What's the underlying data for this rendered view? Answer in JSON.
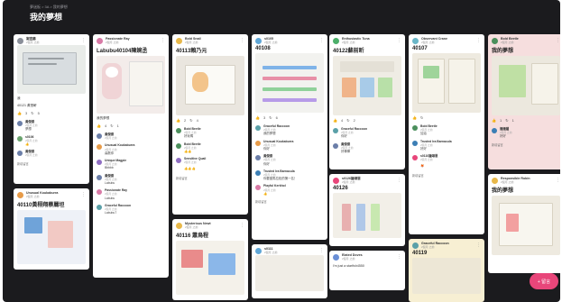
{
  "breadcrumb": "夢迷板 > 3A > 我的夢想",
  "title": "我的夢想",
  "comment_placeholder": "新增留言",
  "fab_label": "+ 留言",
  "like_icon": "👍",
  "reply_icon": "↻",
  "menu_icon": "⋮",
  "columns": [
    {
      "cards": [
        {
          "author": "謝宜蓁",
          "time": "2個月 之前",
          "title": "",
          "note": "我",
          "likes": "3",
          "comments": "5",
          "caption": "40121 黃慧軒",
          "comments_list": [
            {
              "name": "黃傑傑",
              "time": "2個月 之前",
              "body": "夢想"
            },
            {
              "name": "s0106",
              "time": "2個月 之前",
              "body": "👍"
            },
            {
              "name": "黃傑傑",
              "time": "2個月 之前",
              "body": ""
            }
          ]
        },
        {
          "author": "Unusual Koukaburra",
          "time": "2個月 之前",
          "title": "40110黃栩翔蔡麗坦",
          "note": "",
          "likes": "",
          "comments": "",
          "caption": "",
          "comments_list": []
        }
      ]
    },
    {
      "cards": [
        {
          "author": "Passionate Ray",
          "time": "2個月 之前",
          "title": "Labubu40104陳婉丞",
          "note": "我的夢想",
          "likes": "4",
          "comments": "1",
          "caption": "",
          "comments_list": [
            {
              "name": "黃傑傑",
              "time": "2個月 之前",
              "body": ""
            },
            {
              "name": "Unusual Koukaburra",
              "time": "2個月 之前",
              "body": "喜歡你"
            },
            {
              "name": "Unique Magpie",
              "time": "2個月 之前",
              "body": "Bbbbb"
            },
            {
              "name": "黃傑傑",
              "time": "2個月 之前",
              "body": "Labubu"
            },
            {
              "name": "Passionate Ray",
              "time": "2個月 之前",
              "body": "Labubu"
            },
            {
              "name": "Graceful Raccoon",
              "time": "2個月 之前",
              "body": "Labubu7"
            }
          ]
        }
      ]
    },
    {
      "cards": [
        {
          "author": "Bold Snail",
          "time": "2個月 之前",
          "title": "40113賴乃元",
          "note": "",
          "likes": "2",
          "comments": "4",
          "caption": "",
          "comments_list": [
            {
              "name": "Bold Beetle",
              "time": "2個月 之前",
              "body": "好玩嗎"
            },
            {
              "name": "Bold Beetle",
              "time": "2個月 之前",
              "body": "👍👍"
            },
            {
              "name": "Sensitive Quail",
              "time": "2個月 之前",
              "body": "👍👍👍"
            }
          ]
        },
        {
          "author": "Mysterious Newt",
          "time": "2個月 之前",
          "title": "40116 蕭烏程",
          "note": "",
          "likes": "",
          "comments": "",
          "caption": "",
          "comments_list": []
        }
      ]
    },
    {
      "cards": [
        {
          "author": "s0105",
          "time": "2個月 之前",
          "title": "40108",
          "note": "",
          "likes": "3",
          "comments": "6",
          "caption": "",
          "comments_list": [
            {
              "name": "Graceful Raccoon",
              "time": "2個月 之前",
              "body": "我的夢想"
            },
            {
              "name": "Unusual Koukaburra",
              "time": "2個月 之前",
              "body": "你好"
            },
            {
              "name": "黃傑傑",
              "time": "2個月 之前",
              "body": "你好"
            },
            {
              "name": "Trusted Ira Barnacula",
              "time": "2個月 之前",
              "body": "你要當馬拉松的第一名！"
            },
            {
              "name": "Playful Kerkhol",
              "time": "2個月 之前",
              "body": "👍"
            }
          ]
        },
        {
          "author": "s0111",
          "time": "2個月 之前",
          "title": "",
          "note": "",
          "likes": "",
          "comments": "",
          "caption": "",
          "comments_list": []
        }
      ]
    },
    {
      "cards": [
        {
          "author": "Enthusiastic Tuna",
          "time": "2個月 之前",
          "title": "40122蘇前昕",
          "note": "",
          "likes": "4",
          "comments": "2",
          "caption": "",
          "comments_list": [
            {
              "name": "Graceful Raccoon",
              "time": "2個月 之前",
              "body": "你好"
            },
            {
              "name": "黃傑傑",
              "time": "2個月 之前",
              "body": "好棒棒"
            }
          ]
        },
        {
          "author": "s0126鍾頌恩",
          "time": "2個月 之前",
          "title": "40126",
          "note": "",
          "likes": "",
          "comments": "",
          "caption": "",
          "comments_list": []
        },
        {
          "author": "Elated Doves",
          "time": "2個月 之前",
          "title": "",
          "note": "",
          "likes": "",
          "comments": "",
          "caption": "",
          "comments_list": []
        }
      ]
    },
    {
      "cards": [
        {
          "author": "Observant Crane",
          "time": "2個月 之前",
          "title": "40107",
          "note": "",
          "likes": "",
          "comments": "",
          "caption": "",
          "comments_list": [
            {
              "name": "Bold Beetle",
              "time": "2個月 之前",
              "body": "加油"
            },
            {
              "name": "Trusted Ira Barnacula",
              "time": "2個月 之前",
              "body": "好好"
            },
            {
              "name": "s0110鍾頌恩",
              "time": "2個月 之前",
              "body": "🦊"
            }
          ]
        },
        {
          "author": "Graceful Raccoon",
          "time": "2個月 之前",
          "title": "40119",
          "note": "",
          "likes": "",
          "comments": "",
          "caption": "",
          "comments_list": []
        }
      ]
    },
    {
      "cards": [
        {
          "author": "Bold Beetle",
          "time": "2個月 之前",
          "title": "我的夢想",
          "note": "",
          "likes": "1",
          "comments": "1",
          "caption": "",
          "comments_list": [
            {
              "name": "播播爐",
              "time": "2個月 之前",
              "body": "好好"
            }
          ]
        },
        {
          "author": "Responsible Robin",
          "time": "2個月 之前",
          "title": "我的夢想",
          "note": "",
          "likes": "",
          "comments": "",
          "caption": "",
          "comments_list": []
        }
      ]
    }
  ],
  "bottom_text": "I'm just a starfish4550",
  "colors": {
    "background": "#1b1b1e",
    "card": "#ffffff",
    "accent": "#e8467a"
  }
}
